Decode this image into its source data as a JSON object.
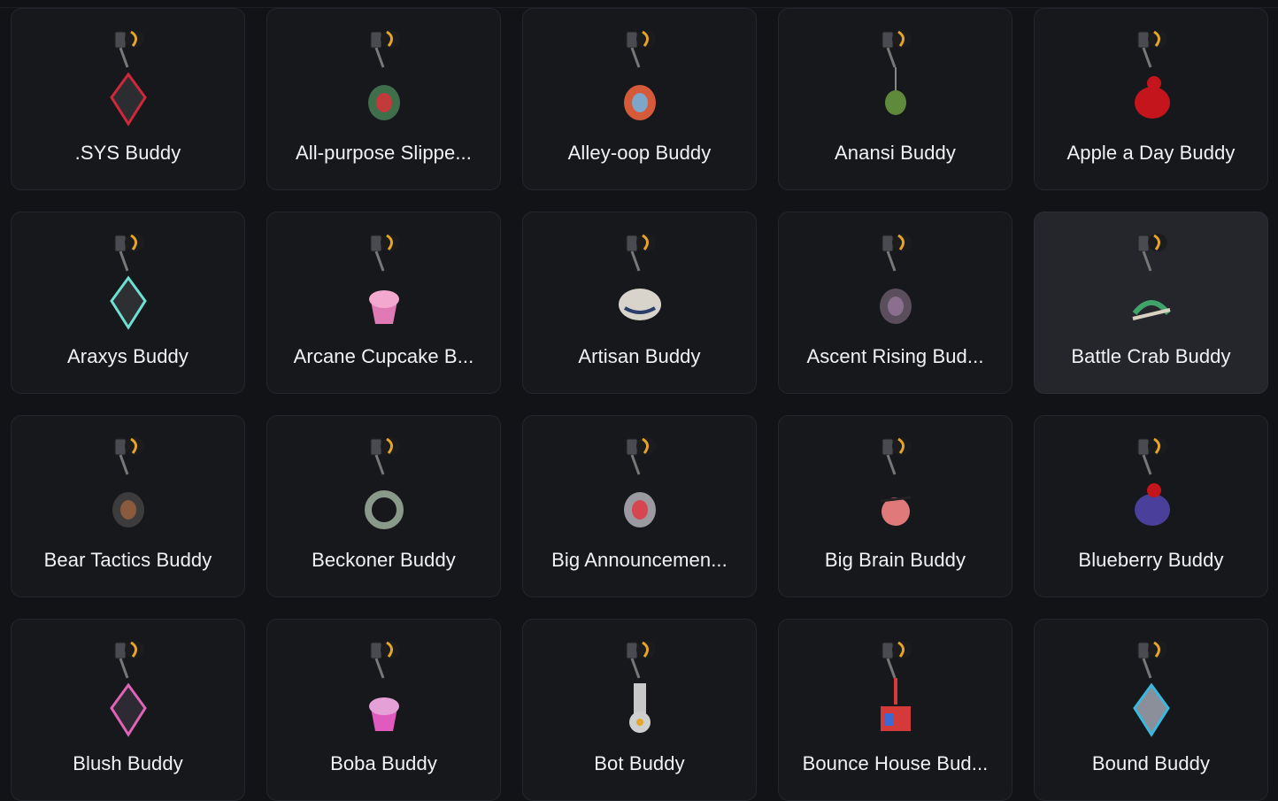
{
  "colors": {
    "background": "#121316",
    "card": "#16181c",
    "card_selected": "#24262b",
    "card_border": "#23262c",
    "text": "#f1f2f4"
  },
  "buddies": [
    {
      "name": ".SYS Buddy",
      "icon": "sys-charm-icon",
      "accent": "#d0283a",
      "body": "#2c2d31",
      "selected": false
    },
    {
      "name": "All-purpose Slippe...",
      "icon": "slipper-charm-icon",
      "accent": "#c23a3a",
      "body": "#3e6f4a",
      "selected": false
    },
    {
      "name": "Alley-oop Buddy",
      "icon": "basketball-hoop-charm-icon",
      "accent": "#7fa6c9",
      "body": "#d45a3a",
      "selected": false
    },
    {
      "name": "Anansi Buddy",
      "icon": "spider-charm-icon",
      "accent": "#5f8a3c",
      "body": "#3a3a3a",
      "selected": false
    },
    {
      "name": "Apple a Day Buddy",
      "icon": "apple-charm-icon",
      "accent": "#c4151c",
      "body": "#6b3a1e",
      "selected": false
    },
    {
      "name": "Araxys Buddy",
      "icon": "araxys-crystal-charm-icon",
      "accent": "#6ee0d2",
      "body": "#2d2f33",
      "selected": false
    },
    {
      "name": "Arcane Cupcake B...",
      "icon": "cupcake-charm-icon",
      "accent": "#e07ab5",
      "body": "#7a4a3a",
      "selected": false
    },
    {
      "name": "Artisan Buddy",
      "icon": "teapot-charm-icon",
      "accent": "#2b3e6b",
      "body": "#d8d4cc",
      "selected": false
    },
    {
      "name": "Ascent Rising Bud...",
      "icon": "floating-island-charm-icon",
      "accent": "#8a6f8e",
      "body": "#5a4e5c",
      "selected": false
    },
    {
      "name": "Battle Crab Buddy",
      "icon": "crab-charm-icon",
      "accent": "#3fa36a",
      "body": "#d9d2c2",
      "selected": true
    },
    {
      "name": "Bear Tactics Buddy",
      "icon": "bear-charm-icon",
      "accent": "#8a5a3c",
      "body": "#3c3c3c",
      "selected": false
    },
    {
      "name": "Beckoner Buddy",
      "icon": "ring-charm-icon",
      "accent": "#8a9a8a",
      "body": "#6b6050",
      "selected": false
    },
    {
      "name": "Big Announcemen...",
      "icon": "megaphone-charm-icon",
      "accent": "#d64550",
      "body": "#9a9aa0",
      "selected": false
    },
    {
      "name": "Big Brain Buddy",
      "icon": "brain-charm-icon",
      "accent": "#e07a7a",
      "body": "#2a2a2a",
      "selected": false
    },
    {
      "name": "Blueberry Buddy",
      "icon": "blueberry-kettle-charm-icon",
      "accent": "#c4151c",
      "body": "#4a3f9a",
      "selected": false
    },
    {
      "name": "Blush Buddy",
      "icon": "blush-orb-charm-icon",
      "accent": "#e063b8",
      "body": "#2d2a33",
      "selected": false
    },
    {
      "name": "Boba Buddy",
      "icon": "boba-cup-charm-icon",
      "accent": "#e05bbd",
      "body": "#2aa6a6",
      "selected": false
    },
    {
      "name": "Bot Buddy",
      "icon": "robot-charm-icon",
      "accent": "#c8c8c8",
      "body": "#9a6a3a",
      "selected": false
    },
    {
      "name": "Bounce House Bud...",
      "icon": "bounce-house-charm-icon",
      "accent": "#d43a3a",
      "body": "#3a6ad4",
      "selected": false
    },
    {
      "name": "Bound Buddy",
      "icon": "bound-crystal-charm-icon",
      "accent": "#3ab8e0",
      "body": "#8a8f9a",
      "selected": false
    }
  ]
}
